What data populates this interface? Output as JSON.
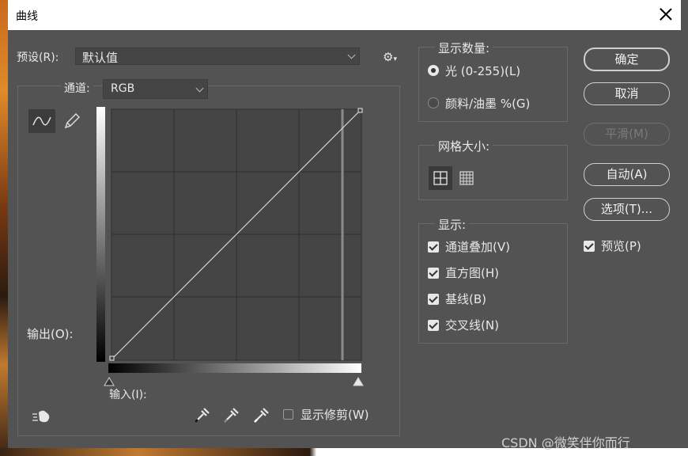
{
  "window": {
    "title": "曲线"
  },
  "preset": {
    "label": "预设(R):",
    "value": "默认值"
  },
  "channel": {
    "label": "通道:",
    "value": "RGB"
  },
  "curve": {
    "output_label": "输出(O):",
    "input_label": "输入(I):",
    "show_clipping_label": "显示修剪(W)"
  },
  "display_amount": {
    "legend": "显示数量:",
    "options": [
      "光 (0-255)(L)",
      "颜料/油墨 %(G)"
    ],
    "selected": 0
  },
  "grid_size": {
    "legend": "网格大小:"
  },
  "display": {
    "legend": "显示:",
    "items": [
      {
        "label": "通道叠加(V)",
        "checked": true
      },
      {
        "label": "直方图(H)",
        "checked": true
      },
      {
        "label": "基线(B)",
        "checked": true
      },
      {
        "label": "交叉线(N)",
        "checked": true
      }
    ]
  },
  "buttons": {
    "ok": "确定",
    "cancel": "取消",
    "smooth": "平滑(M)",
    "auto": "自动(A)",
    "options": "选项(T)..."
  },
  "preview": {
    "label": "预览(P)",
    "checked": true
  },
  "watermark": "CSDN @微笑伴你而行"
}
